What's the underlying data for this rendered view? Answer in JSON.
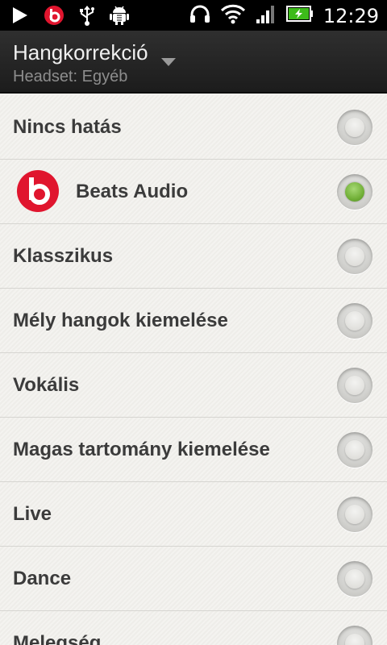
{
  "status_bar": {
    "time": "12:29",
    "icons": [
      "play-icon",
      "beats-icon",
      "usb-icon",
      "android-debug-icon",
      "headphones-icon",
      "wifi-icon",
      "signal-icon",
      "battery-charging-icon"
    ]
  },
  "header": {
    "title": "Hangkorrekció",
    "subtitle": "Headset: Egyéb"
  },
  "options": [
    {
      "label": "Nincs hatás",
      "checked": false
    },
    {
      "label": "Beats Audio",
      "checked": true,
      "icon": "beats-logo-icon"
    },
    {
      "label": "Klasszikus",
      "checked": false
    },
    {
      "label": "Mély hangok kiemelése",
      "checked": false
    },
    {
      "label": "Vokális",
      "checked": false
    },
    {
      "label": "Magas tartomány kiemelése",
      "checked": false
    },
    {
      "label": "Live",
      "checked": false
    },
    {
      "label": "Dance",
      "checked": false
    },
    {
      "label": "Melegség",
      "checked": false
    }
  ],
  "colors": {
    "selected_radio": "#72b038",
    "beats_red": "#e0152e"
  }
}
